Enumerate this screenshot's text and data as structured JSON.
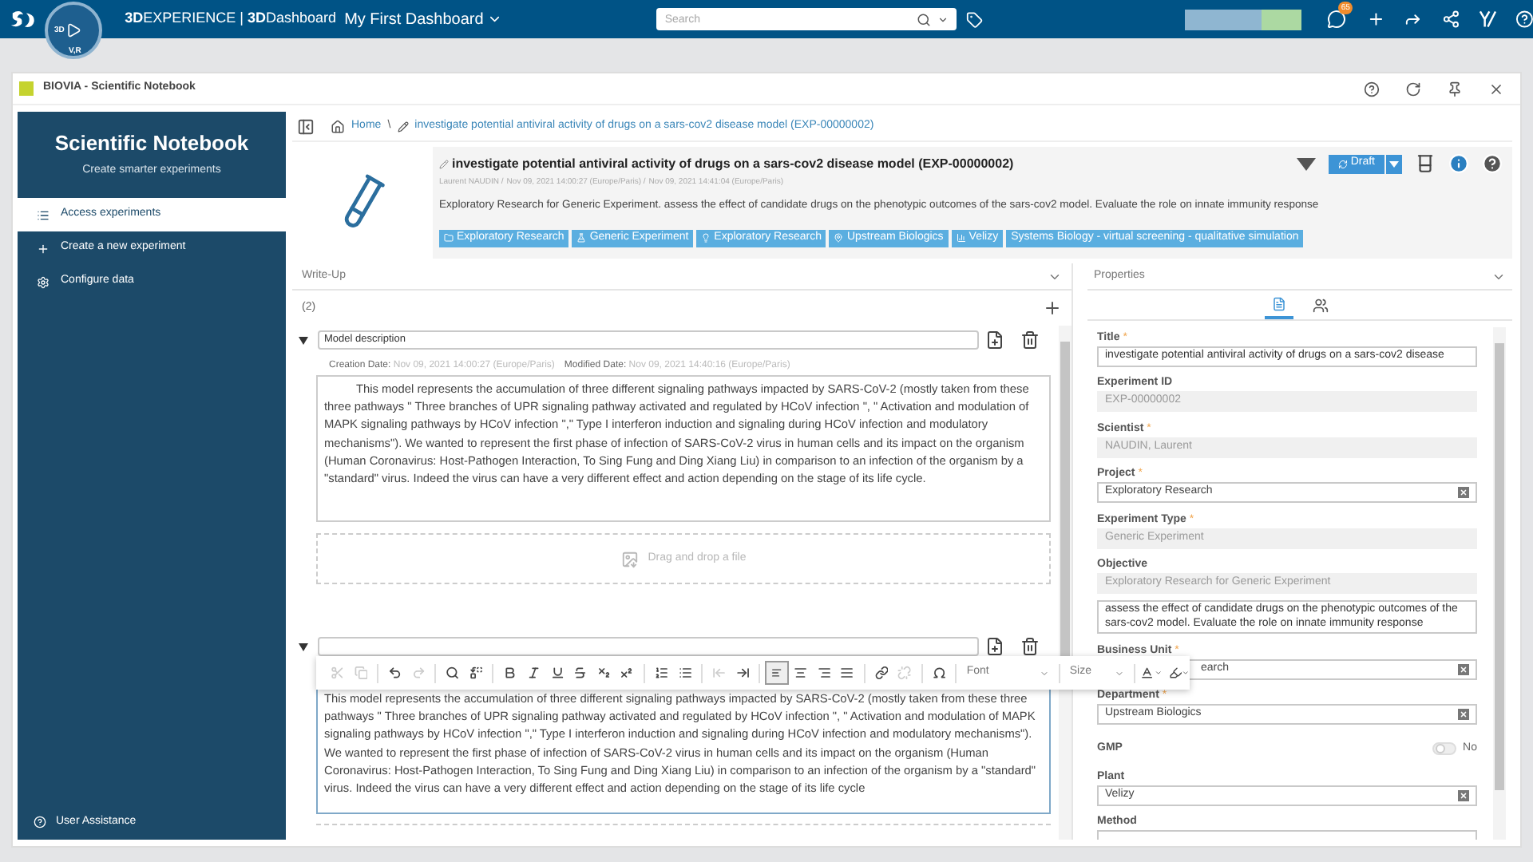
{
  "top_bar": {
    "brand": "**3D**EXPERIENCE | **3D**Dashboard",
    "dashboard": "My First Dashboard",
    "compass_labels": [
      "3D",
      "V,R"
    ],
    "search": {
      "placeholder": "Search"
    },
    "notification_count": "65"
  },
  "window": {
    "title": "BIOVIA - Scientific Notebook"
  },
  "sidebar": {
    "title": "Scientific Notebook",
    "subtitle": "Create smarter experiments",
    "items": [
      {
        "label": "Access experiments",
        "selected": true
      },
      {
        "label": "Create a new experiment",
        "selected": false
      },
      {
        "label": "Configure data",
        "selected": false
      }
    ],
    "footer": "User Assistance"
  },
  "breadcrumb": {
    "home": "Home",
    "separator": "\\",
    "current": "investigate potential antiviral activity of drugs on a sars-cov2 disease model (EXP-00000002)"
  },
  "experiment": {
    "title": "investigate potential antiviral activity of drugs on a sars-cov2 disease model (EXP-00000002)",
    "author": "Laurent NAUDIN /",
    "created": "Nov 09, 2021 14:00:27 (Europe/Paris) /",
    "modified": "Nov 09, 2021 14:41:04 (Europe/Paris)",
    "description": "Exploratory Research for Generic Experiment. assess the effect of candidate drugs on the phenotypic outcomes of the sars-cov2 model. Evaluate the role on innate immunity response",
    "status": "Draft",
    "tags": [
      {
        "label": "Exploratory Research"
      },
      {
        "label": "Generic Experiment"
      },
      {
        "label": "Exploratory Research"
      },
      {
        "label": "Upstream Biologics"
      },
      {
        "label": "Velizy"
      },
      {
        "label": "Systems Biology - virtual screening - qualitative simulation"
      }
    ]
  },
  "writeup": {
    "title": "Write-Up",
    "count": "(2)",
    "entries": [
      {
        "name": "Model description",
        "expanded": true,
        "creation_label": "Creation Date:",
        "creation_date": "Nov 09, 2021 14:00:27 (Europe/Paris)",
        "modified_label": "Modified Date:",
        "modified_date": "Nov 09, 2021 14:40:16 (Europe/Paris)",
        "text": "This model represents the accumulation of three different signaling pathways impacted by SARS-CoV-2 (mostly taken from these three pathways \" Three branches of UPR signaling pathway activated and regulated by HCoV infection \", \" Activation and modulation of MAPK signaling pathways by HCoV infection \",\" Type I interferon induction and signaling during HCoV infection and modulatory mechanisms\"). We wanted to represent the first phase of infection of SARS-CoV-2 virus in human cells and its impact on the organism (Human Coronavirus: Host-Pathogen Interaction, To Sing Fung and Ding Xiang Liu) in comparison to an infection of the organism by a \"standard\" virus. Indeed the virus can have a very different effect and action depending on the stage of its life cycle.",
        "dropzone": "Drag and drop a file"
      },
      {
        "expanded": true,
        "text": "This model represents the accumulation of three different signaling pathways impacted by SARS-CoV-2 (mostly taken from these three pathways \" Three branches of UPR signaling pathway activated and regulated by HCoV infection \", \" Activation and modulation of MAPK signaling pathways by HCoV infection \",\" Type I interferon induction and signaling during HCoV infection and modulatory mechanisms\"). We wanted to represent the first phase of infection of SARS-CoV-2 virus in human cells and its impact on the organism (Human Coronavirus: Host-Pathogen Interaction, To Sing Fung and Ding Xiang Liu) in comparison to an infection of the organism by a \"standard\" virus. Indeed the virus can have a very different effect and action depending on the stage of its life cycle"
      }
    ]
  },
  "editor_toolbar": {
    "groups": [
      [
        {
          "disabled": true
        },
        {
          "disabled": true
        }
      ],
      [
        {
          "disabled": false
        },
        {
          "disabled": true
        }
      ],
      [
        {
          "disabled": false
        },
        {
          "disabled": false
        }
      ],
      [
        {
          "disabled": false
        },
        {
          "disabled": false
        },
        {
          "disabled": false
        },
        {
          "disabled": false
        },
        {
          "disabled": false
        },
        {
          "disabled": false
        }
      ],
      [
        {
          "disabled": false
        },
        {
          "disabled": false
        }
      ],
      [
        {
          "disabled": true
        },
        {
          "disabled": false
        }
      ],
      [
        {
          "disabled": false,
          "selected": true
        },
        {
          "disabled": false,
          "selected": false
        },
        {
          "disabled": false,
          "selected": false
        },
        {
          "disabled": false,
          "selected": false
        }
      ],
      [
        {
          "disabled": false
        },
        {
          "disabled": true
        }
      ],
      [
        {
          "disabled": false
        }
      ]
    ],
    "font": "Font",
    "size": "Size"
  },
  "properties": {
    "title": "Properties",
    "tabs": [
      {
        "selected": true
      },
      {
        "selected": false
      }
    ],
    "fields": [
      {
        "label": "Title",
        "mark": "*",
        "kind": "text",
        "value": "investigate potential antiviral activity of drugs on a sars-cov2 disease"
      },
      {
        "label": "Experiment ID",
        "kind": "readonly",
        "value": "EXP-00000002"
      },
      {
        "label": "Scientist",
        "mark": "*",
        "kind": "readonly",
        "value": "NAUDIN, Laurent"
      },
      {
        "label": "Project",
        "mark": "*",
        "kind": "select",
        "value": "Exploratory Research"
      },
      {
        "label": "Experiment Type",
        "mark": "*",
        "kind": "readonly",
        "value": "Generic Experiment"
      },
      {
        "label": "Objective",
        "kind": "readonly",
        "value": "Exploratory Research for Generic Experiment"
      },
      {
        "kind": "textarea",
        "value": "assess the effect of candidate drugs on the phenotypic outcomes of the sars-cov2 model. Evaluate the role on innate immunity response"
      },
      {
        "label": "Business Unit",
        "mark": "*",
        "kind": "select",
        "value": "earch"
      },
      {
        "label": "Department",
        "mark": "*",
        "kind": "select",
        "value": "Upstream Biologics"
      },
      {
        "label": "GMP",
        "kind": "toggle",
        "on": false,
        "state_text": "No"
      },
      {
        "label": "Plant",
        "kind": "select",
        "value": "Velizy"
      },
      {
        "label": "Method",
        "kind": "select"
      }
    ]
  }
}
